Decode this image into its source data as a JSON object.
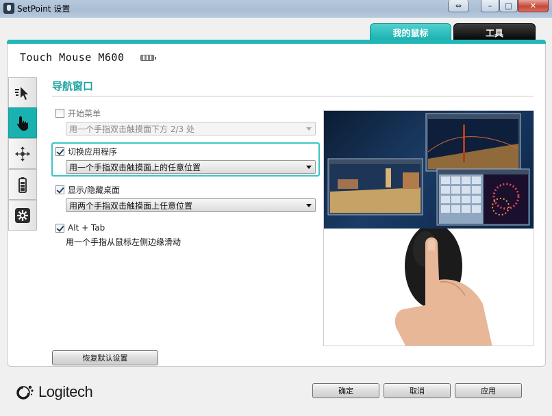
{
  "window": {
    "title": "SetPoint 设置",
    "buttons": {
      "extra": "⇔",
      "minimize": "–",
      "maximize": "□",
      "close": "✕"
    }
  },
  "tabs": [
    {
      "label": "我的鼠标",
      "active": true
    },
    {
      "label": "工具",
      "active": false
    }
  ],
  "device": {
    "name": "Touch Mouse M600",
    "icon": "battery-icon"
  },
  "side_tabs": [
    {
      "icon": "pointer-speed-icon",
      "active": false
    },
    {
      "icon": "touch-hand-icon",
      "active": true
    },
    {
      "icon": "move-arrows-icon",
      "active": false
    },
    {
      "icon": "battery-icon",
      "active": false
    },
    {
      "icon": "settings-star-icon",
      "active": false
    }
  ],
  "section": {
    "title": "导航窗口"
  },
  "options": [
    {
      "label": "开始菜单",
      "checked": false,
      "select": "用一个手指双击触摸面下方 2/3 处",
      "disabled": true
    },
    {
      "label": "切换应用程序",
      "checked": true,
      "select": "用一个手指双击触摸面上的任意位置",
      "disabled": false
    },
    {
      "label": "显示/隐藏桌面",
      "checked": true,
      "select": "用两个手指双击触摸面上任意位置",
      "disabled": false
    },
    {
      "label": "Alt + Tab",
      "checked": true,
      "description": "用一个手指从鼠标左侧边缘滑动"
    }
  ],
  "buttons": {
    "restore_defaults": "恢复默认设置",
    "ok": "确定",
    "cancel": "取消",
    "apply": "应用"
  },
  "brand": {
    "name": "Logitech"
  },
  "colors": {
    "accent": "#1ab1b0",
    "tab_dark": "#111111"
  }
}
